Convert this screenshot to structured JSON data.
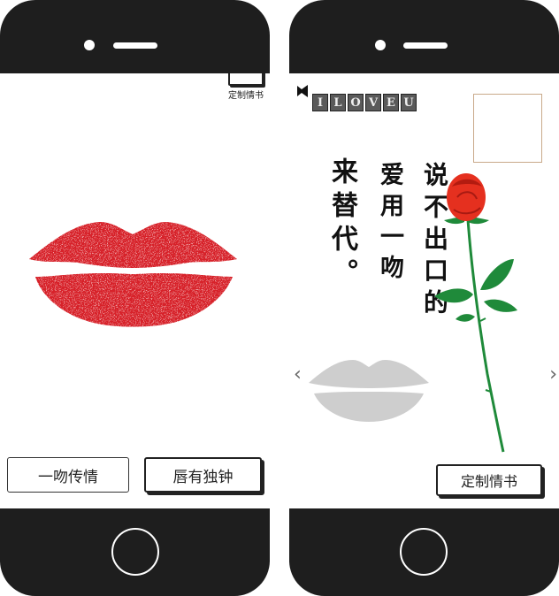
{
  "left_screen": {
    "top_custom_label": "定制情书",
    "button_kiss": "一吻传情",
    "button_lips": "唇有独钟"
  },
  "right_screen": {
    "love_letters": [
      "I",
      "L",
      "O",
      "V",
      "E",
      "U"
    ],
    "poem_col1": "说不出口的",
    "poem_col2": "爱用一吻",
    "poem_col3": "来替代。",
    "nav_prev": "‹",
    "nav_next": "›",
    "custom_button": "定制情书"
  },
  "colors": {
    "phone_frame": "#1e1e1e",
    "lips_red": "#d8232a",
    "rose_red": "#e5301f",
    "leaf_green": "#1f8a3a"
  }
}
